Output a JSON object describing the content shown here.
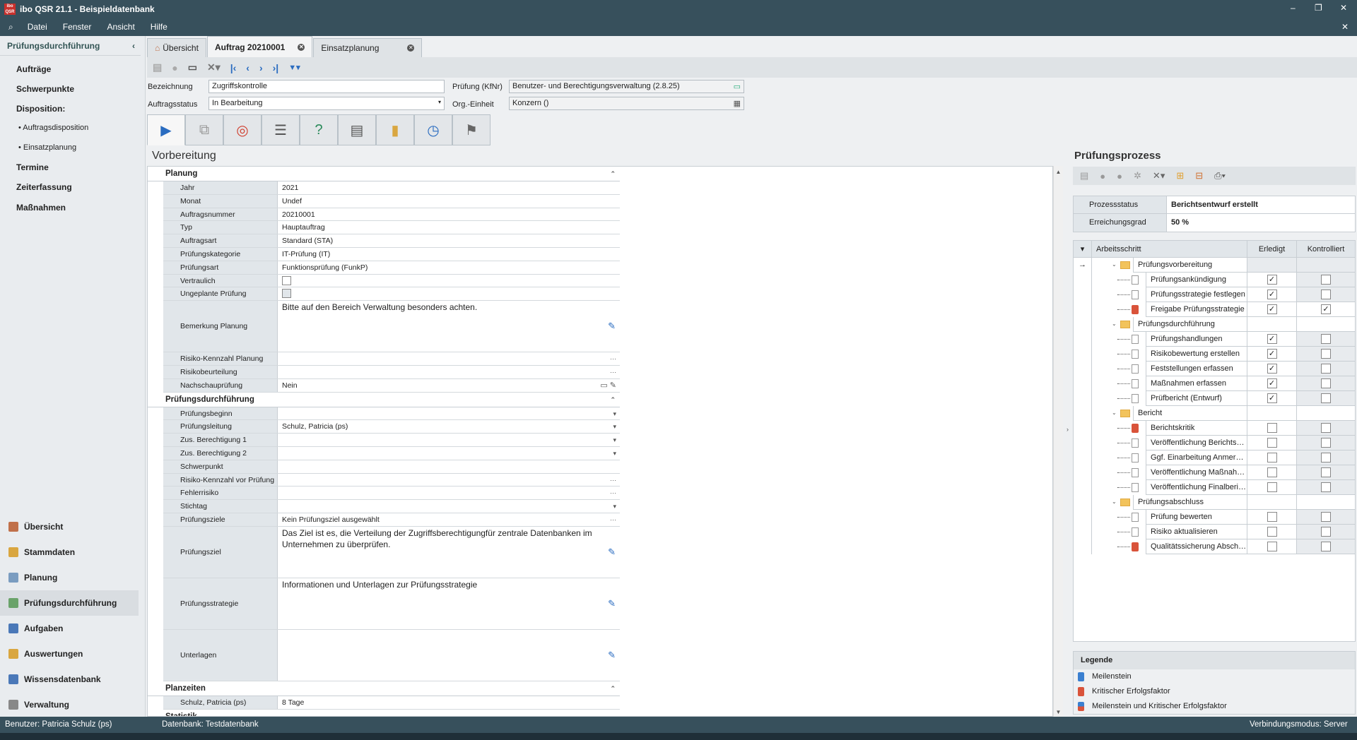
{
  "window": {
    "title": "ibo QSR 21.1 - Beispieldatenbank",
    "logo": "ibo QSR"
  },
  "menu": [
    "Datei",
    "Fenster",
    "Ansicht",
    "Hilfe"
  ],
  "sidebar": {
    "header": "Prüfungsdurchführung",
    "items": [
      {
        "label": "Aufträge",
        "kind": "item"
      },
      {
        "label": "Schwerpunkte",
        "kind": "item"
      },
      {
        "label": "Disposition:",
        "kind": "item"
      },
      {
        "label": "• Auftragsdisposition",
        "kind": "sub"
      },
      {
        "label": "• Einsatzplanung",
        "kind": "sub"
      },
      {
        "label": "Termine",
        "kind": "item"
      },
      {
        "label": "Zeiterfassung",
        "kind": "item"
      },
      {
        "label": "Maßnahmen",
        "kind": "item"
      }
    ],
    "nav": [
      {
        "label": "Übersicht",
        "icon": "home-icon",
        "color": "#c0704a"
      },
      {
        "label": "Stammdaten",
        "icon": "stammdaten-icon",
        "color": "#d9a640"
      },
      {
        "label": "Planung",
        "icon": "chart-icon",
        "color": "#7a9cc0"
      },
      {
        "label": "Prüfungsdurchführung",
        "icon": "audit-icon",
        "color": "#6aa36a",
        "active": true
      },
      {
        "label": "Aufgaben",
        "icon": "calendar-icon",
        "color": "#4a78b8"
      },
      {
        "label": "Auswertungen",
        "icon": "pie-chart-icon",
        "color": "#d9a640"
      },
      {
        "label": "Wissensdatenbank",
        "icon": "database-icon",
        "color": "#4a78b8"
      },
      {
        "label": "Verwaltung",
        "icon": "gear-icon",
        "color": "#888888"
      }
    ]
  },
  "tabs": [
    {
      "label": "Übersicht",
      "icon": "home-icon"
    },
    {
      "label": "Auftrag 20210001",
      "active": true,
      "closable": true
    },
    {
      "label": "Einsatzplanung",
      "closable": true
    }
  ],
  "header": {
    "bezeichnung_label": "Bezeichnung",
    "bezeichnung": "Zugriffskontrolle",
    "status_label": "Auftragsstatus",
    "status": "In Bearbeitung",
    "pruefung_label": "Prüfung (KfNr)",
    "pruefung": "Benutzer- und Berechtigungsverwaltung (2.8.25)",
    "org_label": "Org.-Einheit",
    "org": "Konzern  ()"
  },
  "phase_tabs": [
    "play-icon",
    "process-icon",
    "target-icon",
    "checklist-icon",
    "question-icon",
    "document-icon",
    "folder-icon",
    "calendar-clock-icon",
    "finish-flag-icon"
  ],
  "main": {
    "title": "Vorbereitung",
    "sections": [
      {
        "title": "Planung",
        "collapsed": false,
        "rows": [
          {
            "label": "Jahr",
            "value": "2021"
          },
          {
            "label": "Monat",
            "value": "Undef"
          },
          {
            "label": "Auftragsnummer",
            "value": "20210001"
          },
          {
            "label": "Typ",
            "value": "Hauptauftrag"
          },
          {
            "label": "Auftragsart",
            "value": "Standard (STA)"
          },
          {
            "label": "Prüfungskategorie",
            "value": "IT-Prüfung (IT)"
          },
          {
            "label": "Prüfungsart",
            "value": "Funktionsprüfung (FunkP)"
          },
          {
            "label": "Vertraulich",
            "type": "checkbox",
            "checked": false
          },
          {
            "label": "Ungeplante Prüfung",
            "type": "checkbox",
            "checked": false,
            "disabled": true
          },
          {
            "label": "Bemerkung Planung",
            "type": "memo",
            "value": "Bitte auf den Bereich Verwaltung besonders achten."
          },
          {
            "label": "Risiko-Kennzahl Planung",
            "value": "",
            "type": "ellipsis"
          },
          {
            "label": "Risikobeurteilung",
            "value": "",
            "type": "ellipsis"
          },
          {
            "label": "Nachschauprüfung",
            "value": "Nein",
            "type": "icons"
          }
        ]
      },
      {
        "title": "Prüfungsdurchführung",
        "collapsed": false,
        "rows": [
          {
            "label": "Prüfungsbeginn",
            "value": "",
            "type": "dropdown"
          },
          {
            "label": "Prüfungsleitung",
            "value": "Schulz, Patricia (ps)",
            "type": "dropdown"
          },
          {
            "label": "Zus. Berechtigung 1",
            "value": "",
            "type": "dropdown"
          },
          {
            "label": "Zus. Berechtigung 2",
            "value": "",
            "type": "dropdown"
          },
          {
            "label": "Schwerpunkt",
            "value": ""
          },
          {
            "label": "Risiko-Kennzahl vor Prüfung",
            "value": "",
            "type": "ellipsis"
          },
          {
            "label": "Fehlerrisiko",
            "value": "",
            "type": "ellipsis"
          },
          {
            "label": "Stichtag",
            "value": "",
            "type": "dropdown"
          },
          {
            "label": "Prüfungsziele",
            "value": "Kein Prüfungsziel ausgewählt",
            "type": "ellipsis"
          },
          {
            "label": "Prüfungsziel",
            "type": "memo",
            "value": "Das Ziel ist es, die Verteilung der Zugriffsberechtigungfür zentrale Datenbanken im Unternehmen  zu überprüfen."
          },
          {
            "label": "Prüfungsstrategie",
            "type": "memo",
            "value": "Informationen und Unterlagen zur Prüfungsstrategie"
          },
          {
            "label": "Unterlagen",
            "type": "memo",
            "value": ""
          }
        ]
      },
      {
        "title": "Planzeiten",
        "collapsed": false,
        "rows": [
          {
            "label": "Schulz, Patricia (ps)",
            "value": "8 Tage"
          }
        ]
      },
      {
        "title": "Statistik",
        "collapsed": true,
        "rows": []
      }
    ]
  },
  "process": {
    "title": "Prüfungsprozess",
    "status_label": "Prozessstatus",
    "status": "Berichtsentwurf erstellt",
    "grad_label": "Erreichungsgrad",
    "grad": "50 %",
    "columns": [
      "Arbeitsschritt",
      "Erledigt",
      "Kontrolliert"
    ],
    "rows": [
      {
        "label": "Prüfungsvorbereitung",
        "group": true,
        "current": true
      },
      {
        "label": "Prüfungsankündigung",
        "marker": "doc",
        "done": true,
        "ctrl": false
      },
      {
        "label": "Prüfungsstrategie festlegen",
        "marker": "doc",
        "done": true,
        "ctrl": false
      },
      {
        "label": "Freigabe Prüfungsstrategie",
        "marker": "critical",
        "done": true,
        "ctrl": true
      },
      {
        "label": "Prüfungsdurchführung",
        "group": true
      },
      {
        "label": "Prüfungshandlungen",
        "marker": "doc",
        "done": true,
        "ctrl": false
      },
      {
        "label": "Risikobewertung erstellen",
        "marker": "doc",
        "done": true,
        "ctrl": false
      },
      {
        "label": "Feststellungen erfassen",
        "marker": "doc",
        "done": true,
        "ctrl": false
      },
      {
        "label": "Maßnahmen erfassen",
        "marker": "doc",
        "done": true,
        "ctrl": false
      },
      {
        "label": "Prüfbericht (Entwurf)",
        "marker": "doc",
        "done": true,
        "ctrl": false
      },
      {
        "label": "Bericht",
        "group": true
      },
      {
        "label": "Berichtskritik",
        "marker": "critical",
        "done": false,
        "ctrl": false
      },
      {
        "label": "Veröffentlichung Berichtsentwurf",
        "marker": "doc",
        "done": false,
        "ctrl": false
      },
      {
        "label": "Ggf. Einarbeitung Anmerkungen",
        "marker": "doc",
        "done": false,
        "ctrl": false
      },
      {
        "label": "Veröffentlichung Maßnahmen",
        "marker": "doc",
        "done": false,
        "ctrl": false
      },
      {
        "label": "Veröffentlichung Finalbericht",
        "marker": "doc",
        "done": false,
        "ctrl": false
      },
      {
        "label": "Prüfungsabschluss",
        "group": true
      },
      {
        "label": "Prüfung bewerten",
        "marker": "doc",
        "done": false,
        "ctrl": false
      },
      {
        "label": "Risiko aktualisieren",
        "marker": "doc",
        "done": false,
        "ctrl": false
      },
      {
        "label": "Qualitätssicherung Abschluss",
        "marker": "critical",
        "done": false,
        "ctrl": false
      }
    ],
    "legend": {
      "title": "Legende",
      "items": [
        {
          "label": "Meilenstein",
          "color": "#3a7fd0"
        },
        {
          "label": "Kritischer Erfolgsfaktor",
          "color": "#d9533a"
        },
        {
          "label": "Meilenstein und Kritischer Erfolgsfaktor",
          "color": "split"
        }
      ]
    }
  },
  "statusbar": {
    "user": "Benutzer: Patricia Schulz (ps)",
    "db": "Datenbank: Testdatenbank",
    "mode": "Verbindungsmodus: Server"
  }
}
